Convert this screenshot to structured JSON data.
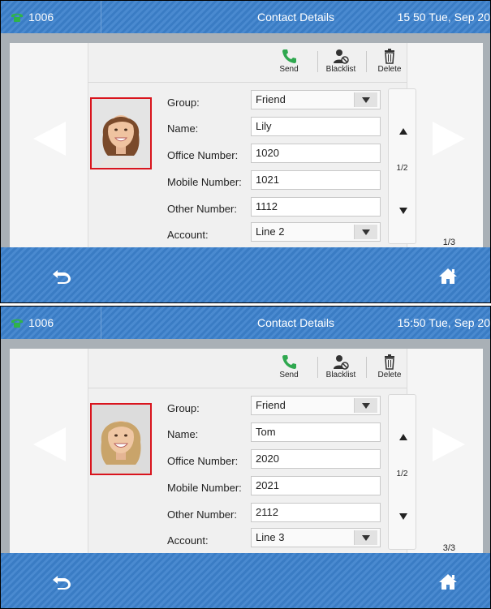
{
  "screens": [
    {
      "status": {
        "account": "1006",
        "title": "Contact Details",
        "time": "15 50 Tue, Sep 20"
      },
      "toolbar": {
        "send": "Send",
        "blacklist": "Blacklist",
        "delete": "Delete"
      },
      "fields": {
        "group_label": "Group:",
        "group_value": "Friend",
        "name_label": "Name:",
        "name_value": "Lily",
        "office_label": "Office Number:",
        "office_value": "1020",
        "mobile_label": "Mobile Number:",
        "mobile_value": "1021",
        "other_label": "Other Number:",
        "other_value": "1112",
        "account_label": "Account:",
        "account_value": "Line 2"
      },
      "scroll_page": "1/2",
      "contact_index": "1/3",
      "photo_hair": "#7a4a2b"
    },
    {
      "status": {
        "account": "1006",
        "title": "Contact Details",
        "time": "15:50 Tue, Sep 20"
      },
      "toolbar": {
        "send": "Send",
        "blacklist": "Blacklist",
        "delete": "Delete"
      },
      "fields": {
        "group_label": "Group:",
        "group_value": "Friend",
        "name_label": "Name:",
        "name_value": "Tom",
        "office_label": "Office Number:",
        "office_value": "2020",
        "mobile_label": "Mobile Number:",
        "mobile_value": "2021",
        "other_label": "Other Number:",
        "other_value": "2112",
        "account_label": "Account:",
        "account_value": "Line 3"
      },
      "scroll_page": "1/2",
      "contact_index": "3/3",
      "photo_hair": "#c9a46a"
    }
  ],
  "icons": {
    "account": "phone-icon",
    "send": "phone-send-icon",
    "blacklist": "user-block-icon",
    "delete": "trash-icon",
    "back": "back-arrow-icon",
    "home": "home-icon"
  }
}
